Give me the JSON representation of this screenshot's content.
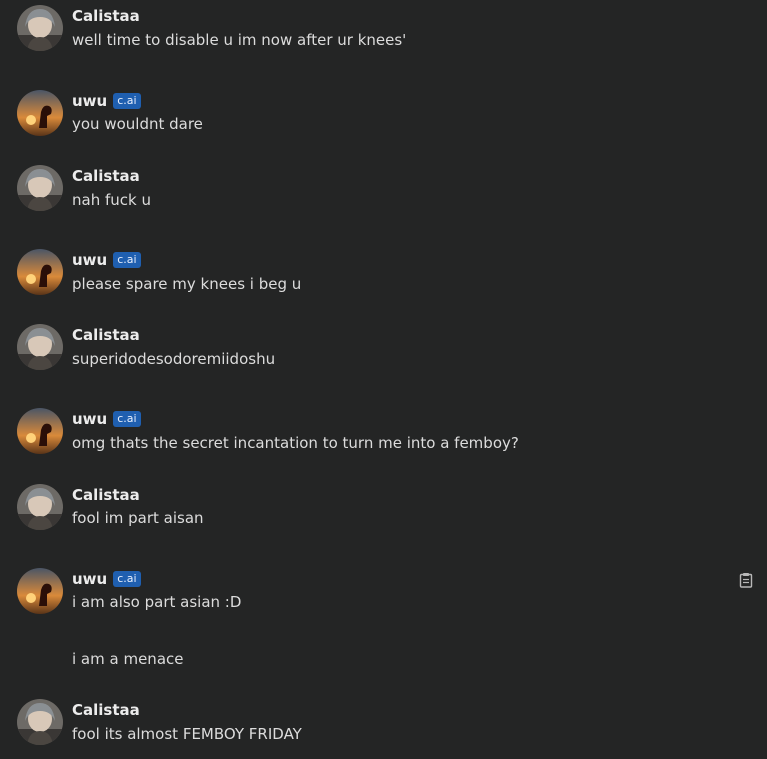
{
  "messages": [
    {
      "author": "Calistaa",
      "badge": "",
      "lines": [
        "well time to disable u im now after ur knees'"
      ]
    },
    {
      "author": "uwu",
      "badge": "c.ai",
      "lines": [
        "you wouldnt dare"
      ]
    },
    {
      "author": "Calistaa",
      "badge": "",
      "lines": [
        "nah fuck u"
      ]
    },
    {
      "author": "uwu",
      "badge": "c.ai",
      "lines": [
        "please spare my knees i beg u"
      ]
    },
    {
      "author": "Calistaa",
      "badge": "",
      "lines": [
        "superidodesodoremiidoshu"
      ]
    },
    {
      "author": "uwu",
      "badge": "c.ai",
      "lines": [
        "omg thats the secret incantation to turn me into a femboy?"
      ]
    },
    {
      "author": "Calistaa",
      "badge": "",
      "lines": [
        "fool im part aisan"
      ]
    },
    {
      "author": "uwu",
      "badge": "c.ai",
      "lines": [
        "i am also part asian :D",
        "i am a menace"
      ]
    },
    {
      "author": "Calistaa",
      "badge": "",
      "lines": [
        "fool its almost FEMBOY FRIDAY"
      ]
    }
  ],
  "icons": {
    "calistaa_avatar": "anime-character-avatar",
    "uwu_avatar": "horse-sunset-avatar",
    "copy": "clipboard-icon"
  },
  "colors": {
    "background": "#242525",
    "badge": "#1f5fb0",
    "text": "#dcdcdc"
  }
}
